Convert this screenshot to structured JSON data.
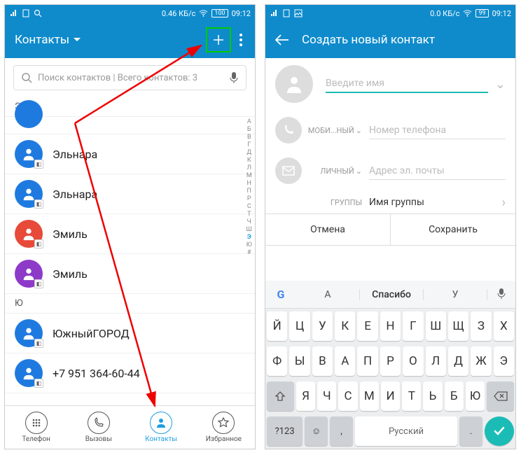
{
  "status": {
    "data_speed_l": "0.46 КБ/с",
    "data_speed_r": "0.0 КБ/с",
    "battery": "100",
    "battery_r": "99",
    "time": "09:12"
  },
  "left": {
    "title": "Контакты",
    "search_placeholder": "Поиск контактов | Всего контактов: 3",
    "section1": "Э",
    "section2": "Ю",
    "contacts": [
      {
        "name": "Эльнара",
        "color": "#1f7ae0"
      },
      {
        "name": "Эльнара",
        "color": "#1f7ae0"
      },
      {
        "name": "Эмиль",
        "color": "#e84a3a"
      },
      {
        "name": "Эмиль",
        "color": "#8e3ac9"
      },
      {
        "name": "ЮжныйГОРОД",
        "color": "#1f7ae0"
      },
      {
        "name": "+7 951 364-60-44",
        "color": "#1f7ae0"
      }
    ],
    "alpha": [
      "A",
      "Б",
      "В",
      "Г",
      "Д",
      "К",
      "Л",
      "М",
      "Н",
      "П",
      "Р",
      "С",
      "Т",
      "Ч",
      "Ш",
      "Э",
      "Ю",
      "#"
    ],
    "nav": {
      "phone": "Телефон",
      "calls": "Вызовы",
      "contacts": "Контакты",
      "fav": "Избранное"
    }
  },
  "right": {
    "title": "Создать новый контакт",
    "name_ph": "Введите имя",
    "phone_lbl": "МОБИ...НЫЙ",
    "phone_ph": "Номер телефона",
    "email_lbl": "ЛИЧНЫЙ",
    "email_ph": "Адрес эл. почты",
    "group_lbl": "ГРУППЫ",
    "group_ph": "Имя группы",
    "cancel": "Отмена",
    "save": "Сохранить",
    "sugg": [
      "А",
      "Спасибо",
      "У"
    ],
    "rows": [
      [
        "Й",
        "Ц",
        "У",
        "К",
        "Е",
        "Н",
        "Г",
        "Ш",
        "Щ",
        "З",
        "Х"
      ],
      [
        "Ф",
        "Ы",
        "В",
        "А",
        "П",
        "Р",
        "О",
        "Л",
        "Д",
        "Ж",
        "Э"
      ],
      [
        "Я",
        "Ч",
        "С",
        "М",
        "И",
        "Т",
        "Ь",
        "Б",
        "Ю"
      ]
    ],
    "space": "Русский",
    "num": "?123"
  }
}
